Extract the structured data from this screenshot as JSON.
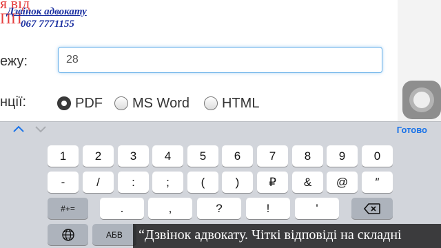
{
  "ad": {
    "bg_text_1": "я від",
    "bg_text_2": "ПП",
    "title": "Дзвінок адвокату",
    "phone": "067 7771155"
  },
  "form": {
    "field_label": "ежу:",
    "field_value": "28",
    "format_label": "нції:",
    "formats": [
      "PDF",
      "MS Word",
      "HTML"
    ],
    "selected_format": "PDF"
  },
  "accessory": {
    "prev_icon": "chevron-up-icon",
    "next_icon": "chevron-down-icon",
    "done_label": "Готово"
  },
  "keyboard": {
    "row1": [
      "1",
      "2",
      "3",
      "4",
      "5",
      "6",
      "7",
      "8",
      "9",
      "0"
    ],
    "row2": [
      "-",
      "/",
      ":",
      ";",
      "(",
      ")",
      "₽",
      "&",
      "@",
      "″"
    ],
    "row3_shift": "#+=",
    "row3": [
      ".",
      ",",
      "?",
      "!",
      "'"
    ],
    "row3_delete_icon": "backspace-icon",
    "row4_globe_icon": "globe-icon",
    "row4_language": "АБВ"
  },
  "subtitle": {
    "text": "“Дзвінок адвокату. Чіткі відповіді на складні"
  },
  "colors": {
    "accent": "#1a73e8",
    "input_border": "#66afe9",
    "ad_text": "#1a2fa0",
    "ad_bg_text": "#e53d3d"
  }
}
